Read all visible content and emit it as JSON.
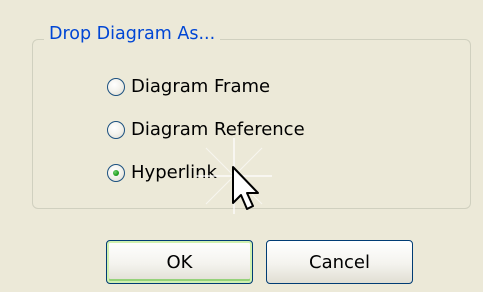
{
  "dialog": {
    "group_title": "Drop Diagram As...",
    "options": [
      {
        "label": "Diagram Frame",
        "selected": false
      },
      {
        "label": "Diagram Reference",
        "selected": false
      },
      {
        "label": "Hyperlink",
        "selected": true
      }
    ],
    "buttons": {
      "ok_label": "OK",
      "cancel_label": "Cancel"
    }
  },
  "colors": {
    "background": "#ece9d8",
    "group_title": "#0046d5",
    "radio_selected": "#21a121",
    "button_border": "#003c74",
    "ok_focus_ring": "#95d27a"
  },
  "cursor": {
    "icon": "mouse-pointer-icon"
  }
}
